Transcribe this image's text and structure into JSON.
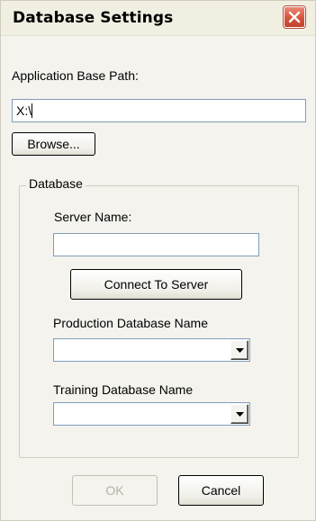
{
  "window": {
    "title": "Database Settings",
    "close_icon": "close-x-icon"
  },
  "app_path": {
    "label": "Application Base Path:",
    "value": "X:\\",
    "browse_label": "Browse..."
  },
  "database": {
    "group_label": "Database",
    "server_label": "Server Name:",
    "server_value": "",
    "connect_label": "Connect To Server",
    "production_label": "Production Database Name",
    "production_value": "",
    "training_label": "Training Database Name",
    "training_value": "",
    "dropdown_icon": "dropdown-arrow-icon"
  },
  "footer": {
    "ok_label": "OK",
    "ok_enabled": false,
    "cancel_label": "Cancel"
  },
  "colors": {
    "close_button": "#d7533d",
    "dialog_background": "#f4f3ee",
    "input_border": "#7f9db9"
  }
}
